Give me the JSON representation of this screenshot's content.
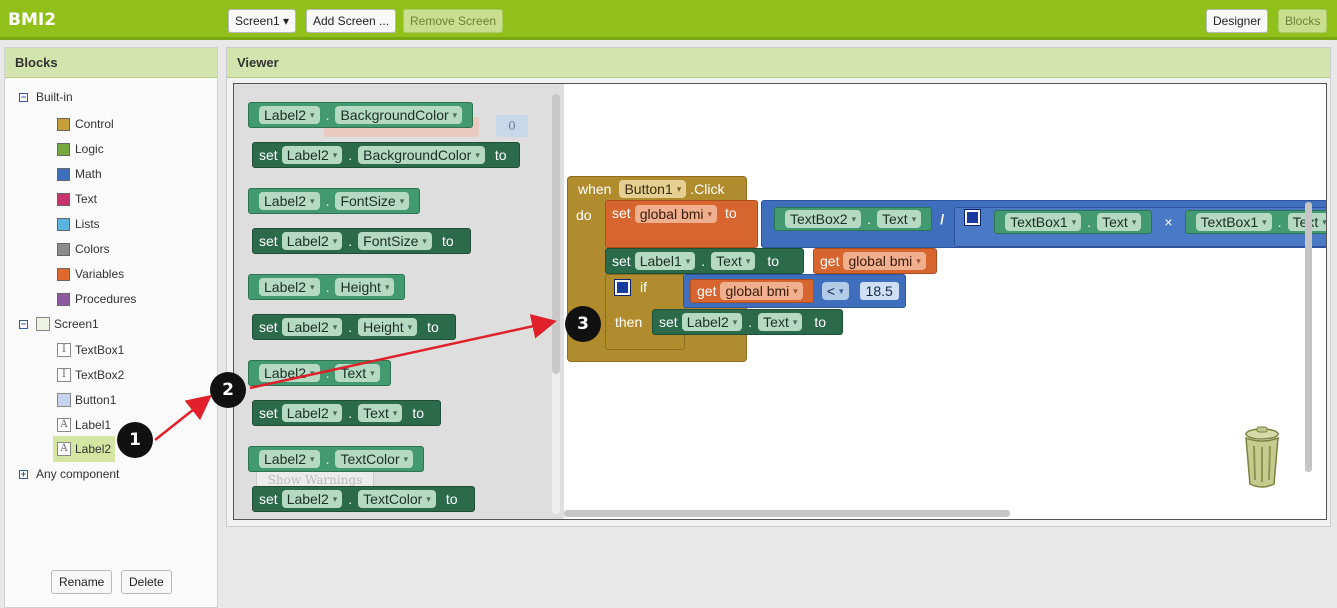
{
  "app": {
    "title": "BMI2"
  },
  "toolbar": {
    "screen_select": "Screen1 ▾",
    "add_screen": "Add Screen ...",
    "remove_screen": "Remove Screen",
    "designer": "Designer",
    "blocks": "Blocks"
  },
  "blocks_panel": {
    "title": "Blocks",
    "builtin": {
      "label": "Built-in",
      "items": [
        {
          "label": "Control",
          "color": "#c69f3a"
        },
        {
          "label": "Logic",
          "color": "#77a840"
        },
        {
          "label": "Math",
          "color": "#3f6fbc"
        },
        {
          "label": "Text",
          "color": "#c9336d"
        },
        {
          "label": "Lists",
          "color": "#5ab5de"
        },
        {
          "label": "Colors",
          "color": "#8c8c8c"
        },
        {
          "label": "Variables",
          "color": "#e06a2d"
        },
        {
          "label": "Procedures",
          "color": "#8c5a9e"
        }
      ]
    },
    "screen": {
      "label": "Screen1",
      "components": [
        {
          "label": "TextBox1",
          "icon": "I"
        },
        {
          "label": "TextBox2",
          "icon": "I"
        },
        {
          "label": "Button1",
          "icon": ""
        },
        {
          "label": "Label1",
          "icon": "A"
        },
        {
          "label": "Label2",
          "icon": "A"
        }
      ]
    },
    "any_component": "Any component",
    "rename": "Rename",
    "delete": "Delete"
  },
  "viewer": {
    "title": "Viewer",
    "flyout": {
      "label2": "Label2",
      "dot": ".",
      "set": "set",
      "to": "to",
      "props": [
        "BackgroundColor",
        "FontSize",
        "Height",
        "Text",
        "TextColor"
      ],
      "ghost_warnings": "Show Warnings",
      "ghost_zero": "0"
    },
    "event": {
      "when": "when",
      "component": "Button1",
      "event": ".Click",
      "do": "do",
      "set": "set",
      "global_bmi": "global bmi",
      "to": "to",
      "textbox2": "TextBox2",
      "textbox1": "TextBox1",
      "text_prop": "Text",
      "divide": "/",
      "times": "×",
      "label1": "Label1",
      "get": "get",
      "if": "if",
      "then": "then",
      "lt": "<",
      "value": "18.5",
      "label2": "Label2"
    }
  },
  "annotations": [
    "1",
    "2",
    "3"
  ]
}
